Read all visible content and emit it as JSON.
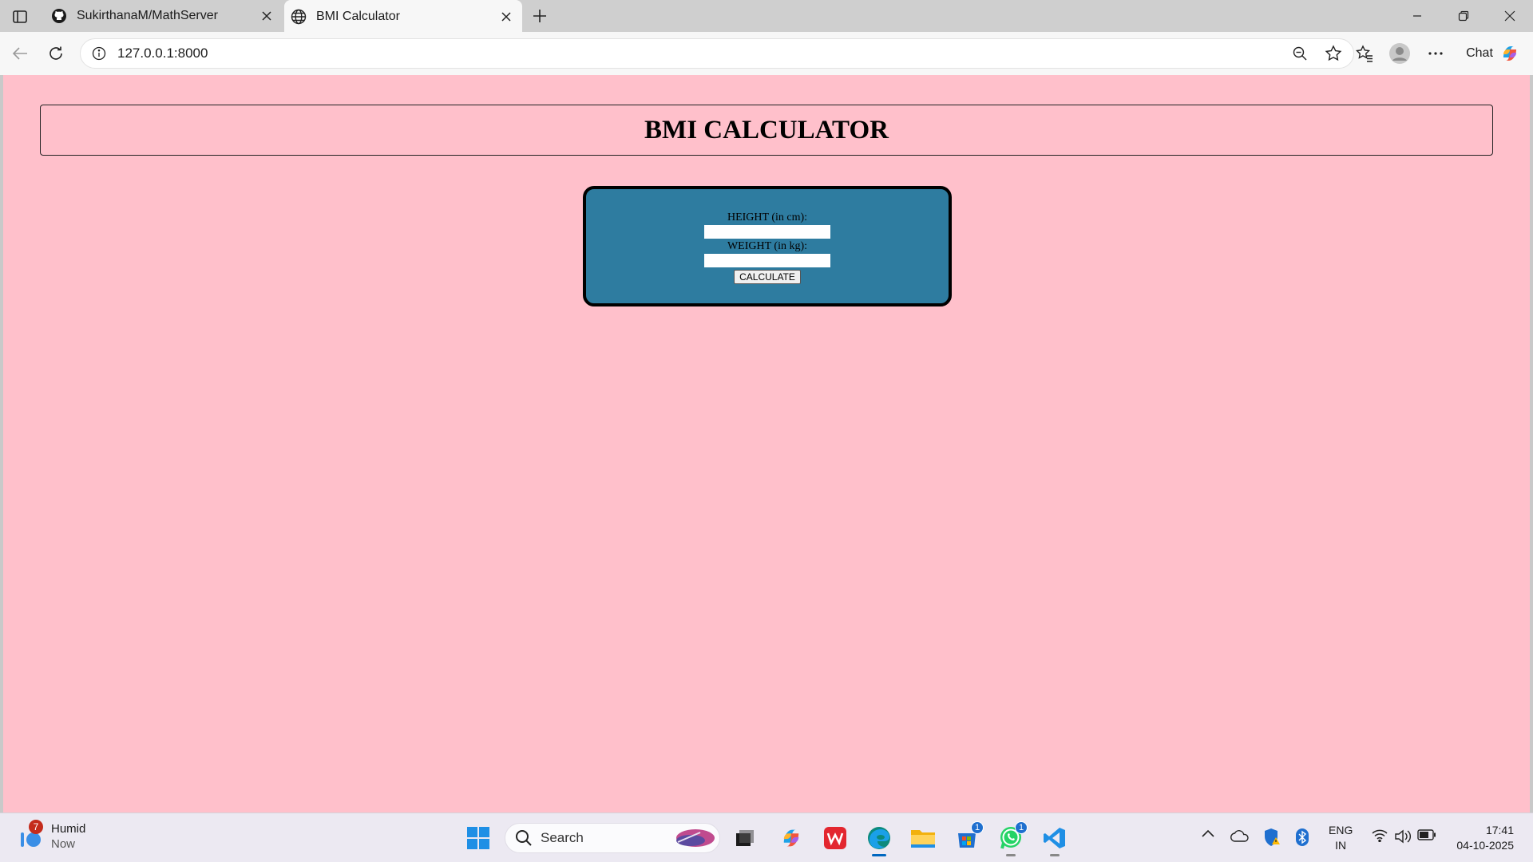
{
  "browser": {
    "tabs": [
      {
        "title": "SukirthanaM/MathServer",
        "icon": "github-icon",
        "active": false
      },
      {
        "title": "BMI Calculator",
        "icon": "globe-icon",
        "active": true
      }
    ],
    "url": "127.0.0.1:8000",
    "chat_label": "Chat"
  },
  "page": {
    "heading": "BMI CALCULATOR",
    "background_color": "#ffc0cb",
    "card_color": "#2e7ca0",
    "form": {
      "height_label": "HEIGHT (in cm):",
      "height_value": "",
      "weight_label": "WEIGHT (in kg):",
      "weight_value": "",
      "calculate_label": "CALCULATE"
    }
  },
  "taskbar": {
    "weather": {
      "title": "Humid",
      "subtitle": "Now",
      "badge": "7"
    },
    "search_placeholder": "Search",
    "apps": [
      {
        "name": "start-icon"
      },
      {
        "name": "task-view-icon"
      },
      {
        "name": "copilot-icon"
      },
      {
        "name": "wps-office-icon"
      },
      {
        "name": "edge-icon",
        "active": true
      },
      {
        "name": "file-explorer-icon"
      },
      {
        "name": "microsoft-store-icon",
        "badge": "1"
      },
      {
        "name": "whatsapp-icon",
        "badge": "1"
      },
      {
        "name": "vscode-icon"
      }
    ],
    "language": {
      "line1": "ENG",
      "line2": "IN"
    },
    "clock": {
      "time": "17:41",
      "date": "04-10-2025"
    }
  }
}
